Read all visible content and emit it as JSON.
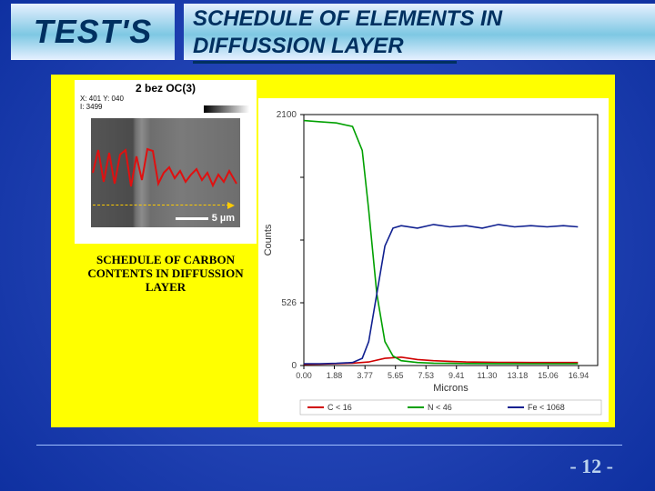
{
  "header": {
    "label": "TEST'S",
    "title_line1": "SCHEDULE OF ELEMENTS IN",
    "title_line2": "DIFFUSSION LAYER"
  },
  "sem_panel": {
    "title": "2 bez OC(3)",
    "meta_line1": "X: 401 Y: 040",
    "meta_line2": "I: 3499",
    "scale_label": "5 µm"
  },
  "sem_caption": "SCHEDULE OF CARBON CONTENTS IN DIFFUSSION LAYER",
  "chart_data": {
    "type": "line",
    "title": "",
    "xlabel": "Microns",
    "ylabel": "Counts",
    "xlim": [
      0,
      18.12
    ],
    "ylim": [
      0,
      2100
    ],
    "x_ticks": [
      0.0,
      1.88,
      3.77,
      5.65,
      7.53,
      9.41,
      11.3,
      13.18,
      15.06,
      16.94
    ],
    "y_ticks": [
      0,
      525,
      1050,
      1575,
      2100
    ],
    "y_tick_labels": [
      "0",
      "526",
      "",
      "",
      "2100"
    ],
    "series": [
      {
        "name": "C < 16",
        "color": "#d00000",
        "x": [
          0.0,
          1.0,
          2.0,
          3.0,
          4.0,
          5.0,
          6.0,
          7.0,
          8.0,
          9.0,
          10.0,
          11.0,
          12.0,
          13.0,
          14.0,
          15.0,
          16.0,
          16.9
        ],
        "values": [
          10,
          12,
          15,
          20,
          30,
          60,
          70,
          50,
          40,
          35,
          30,
          28,
          27,
          26,
          25,
          25,
          25,
          25
        ]
      },
      {
        "name": "N < 46",
        "color": "#00a000",
        "x": [
          0.0,
          1.0,
          2.0,
          3.0,
          3.6,
          4.0,
          4.5,
          5.0,
          5.5,
          6.0,
          7.0,
          8.0,
          9.0,
          10.0,
          12.0,
          14.0,
          16.0,
          16.9
        ],
        "values": [
          2050,
          2040,
          2030,
          2000,
          1800,
          1300,
          600,
          200,
          80,
          40,
          25,
          20,
          18,
          17,
          16,
          15,
          15,
          15
        ]
      },
      {
        "name": "Fe < 1068",
        "color": "#102090",
        "x": [
          0.0,
          1.0,
          2.0,
          3.0,
          3.6,
          4.0,
          4.5,
          5.0,
          5.5,
          6.0,
          7.0,
          8.0,
          9.0,
          10.0,
          11.0,
          12.0,
          13.0,
          14.0,
          15.0,
          16.0,
          16.9
        ],
        "values": [
          15,
          15,
          18,
          25,
          60,
          200,
          600,
          1000,
          1150,
          1170,
          1150,
          1180,
          1160,
          1170,
          1150,
          1180,
          1160,
          1170,
          1160,
          1170,
          1160
        ]
      }
    ],
    "legend_position": "bottom"
  },
  "footer": {
    "page": "- 12 -"
  }
}
